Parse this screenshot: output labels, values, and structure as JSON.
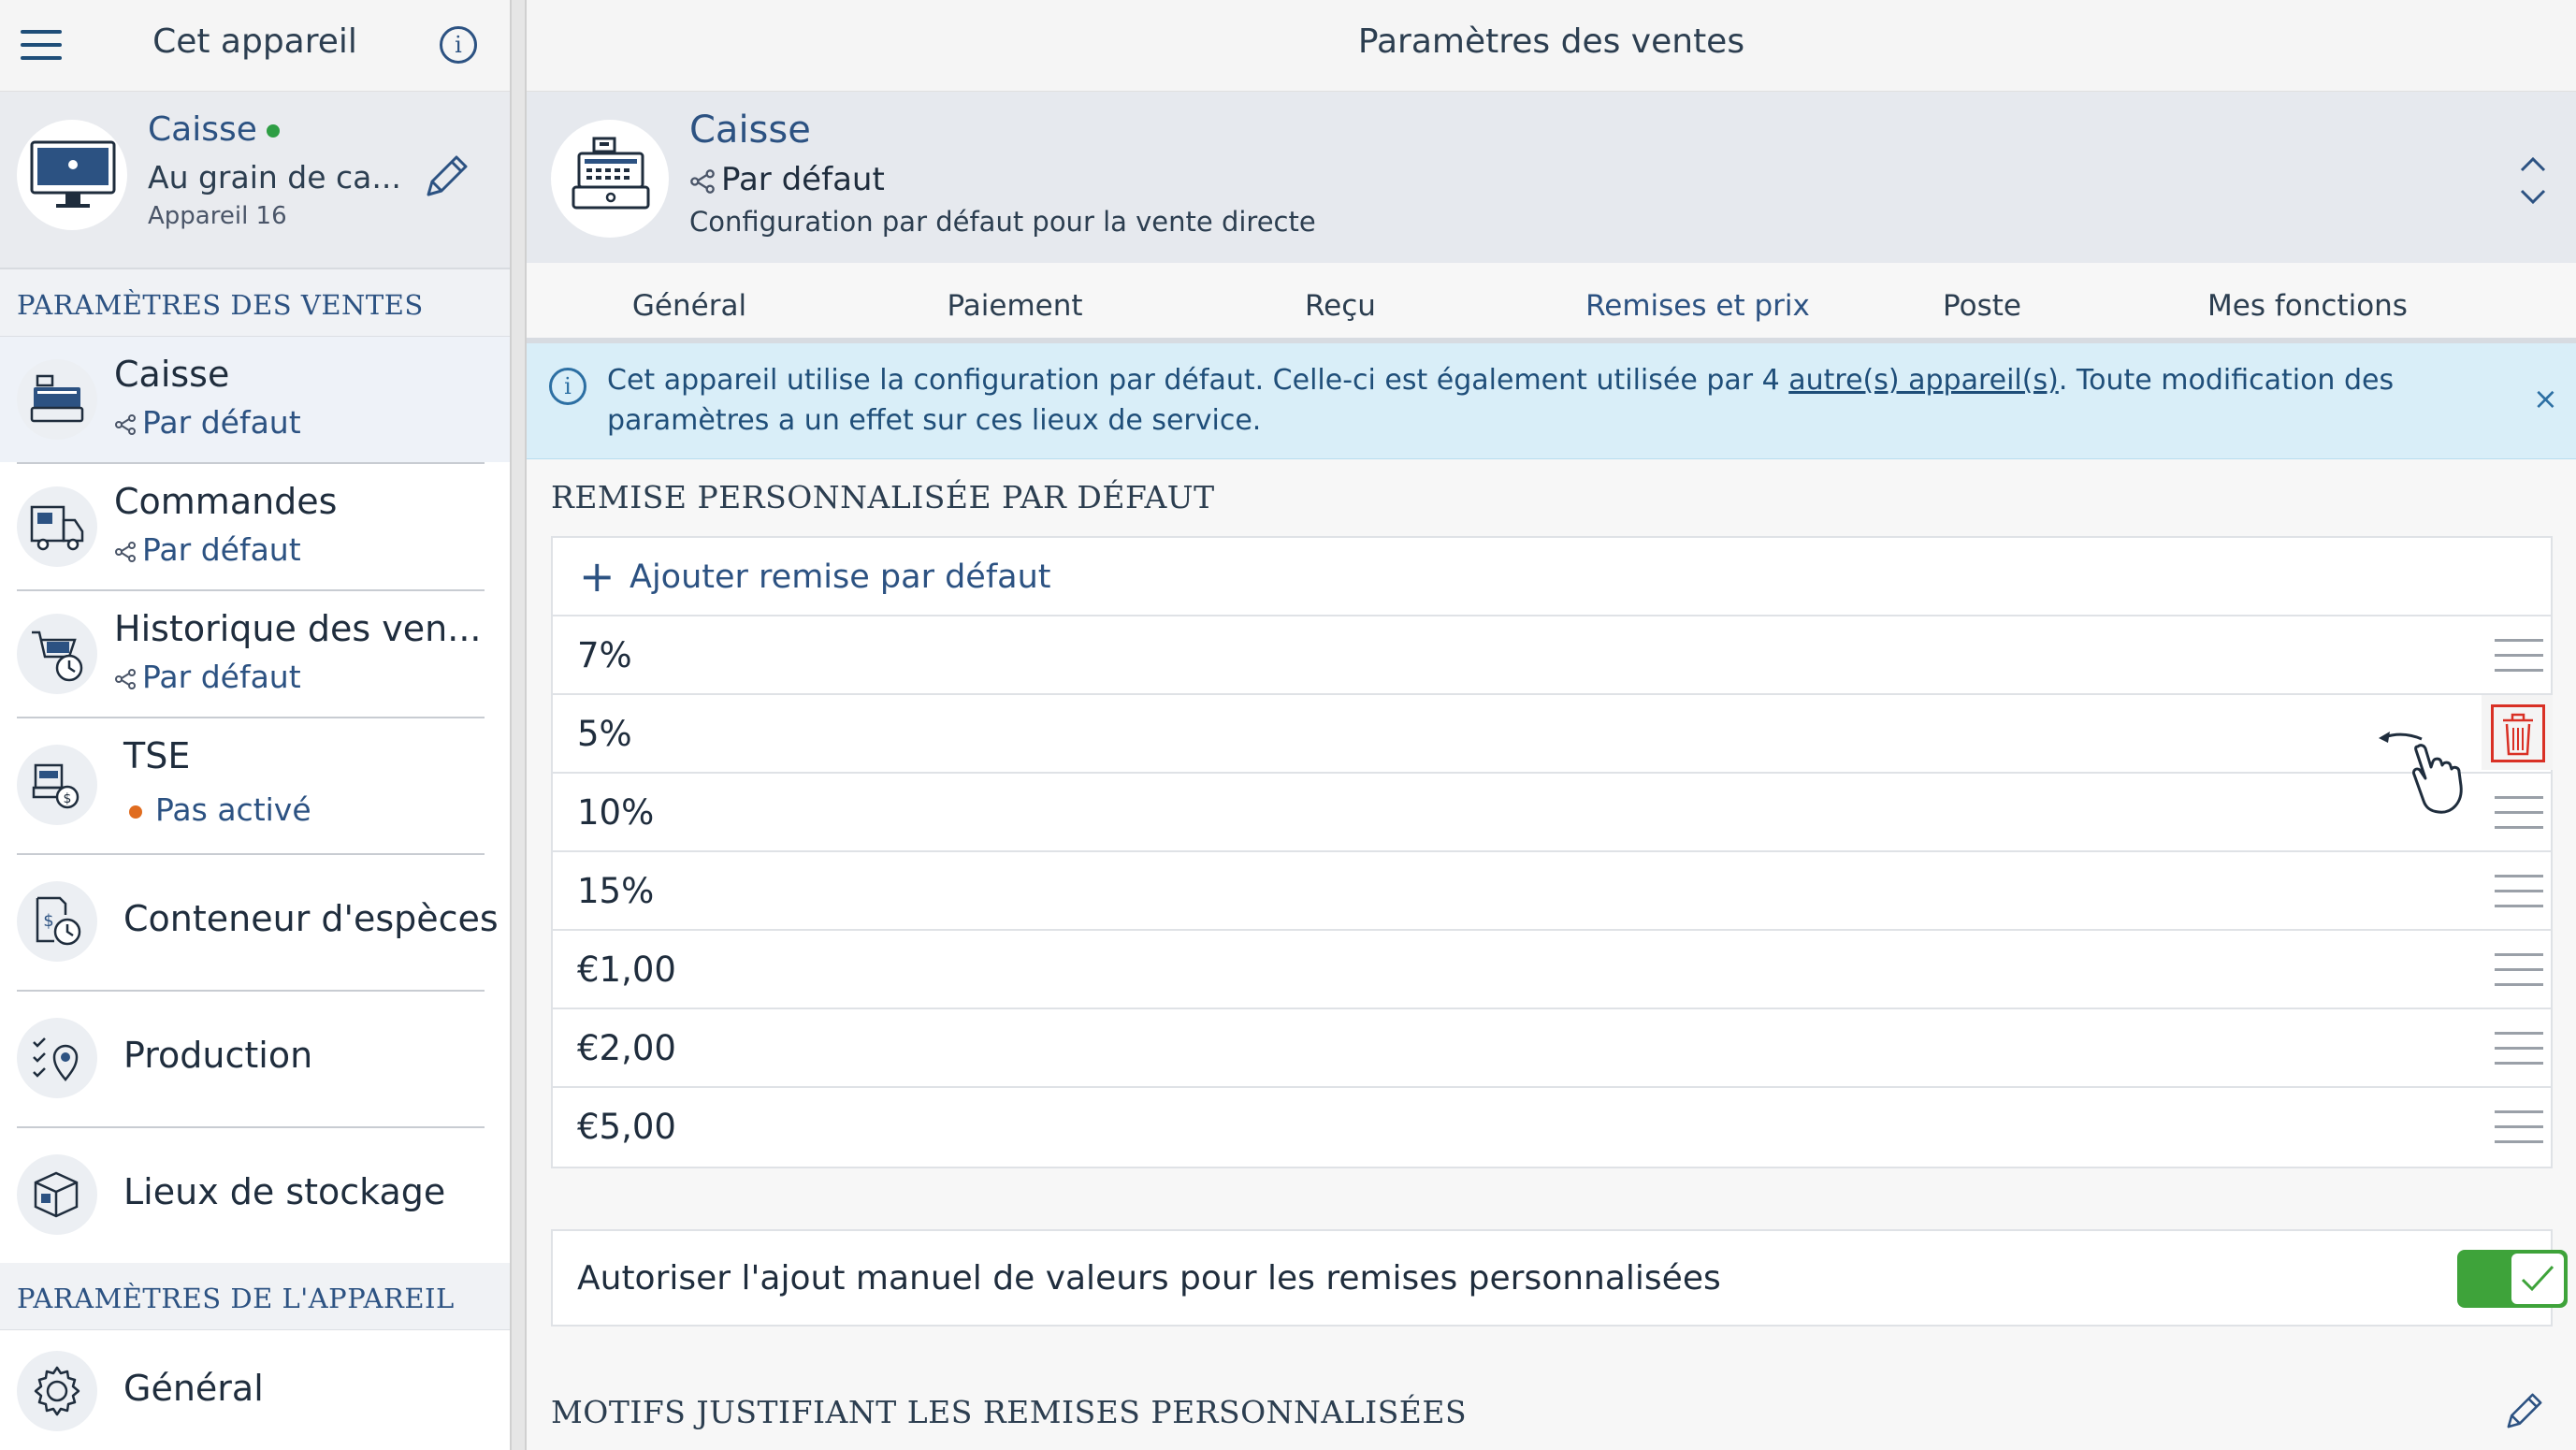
{
  "sidebar": {
    "title": "Cet appareil",
    "device": {
      "name": "Caisse",
      "status_color": "#2e9e44",
      "store": "Au grain de ca...",
      "label": "Appareil 16"
    },
    "sections": {
      "sales": "PARAMÈTRES DES VENTES",
      "device": "PARAMÈTRES DE L'APPAREIL"
    },
    "items": [
      {
        "label": "Caisse",
        "sub": "Par défaut",
        "icon": "cash-register-icon",
        "active": true
      },
      {
        "label": "Commandes",
        "sub": "Par défaut",
        "icon": "delivery-truck-icon"
      },
      {
        "label": "Historique des ven...",
        "sub": "Par défaut",
        "icon": "sales-history-icon"
      },
      {
        "label": "TSE",
        "sub": "Pas activé",
        "icon": "tse-icon",
        "status_color": "#e06c1f"
      },
      {
        "label": "Conteneur d'espèces",
        "icon": "cash-container-icon"
      },
      {
        "label": "Production",
        "icon": "production-icon"
      },
      {
        "label": "Lieux de stockage",
        "icon": "storage-icon"
      },
      {
        "label": "Général",
        "icon": "gear-icon"
      }
    ]
  },
  "main": {
    "title": "Paramètres des ventes",
    "config": {
      "name": "Caisse",
      "profile": "Par défaut",
      "description": "Configuration par défaut pour la vente directe"
    },
    "tabs": [
      {
        "label": "Général"
      },
      {
        "label": "Paiement"
      },
      {
        "label": "Reçu"
      },
      {
        "label": "Remises et prix",
        "active": true
      },
      {
        "label": "Poste"
      },
      {
        "label": "Mes fonctions"
      }
    ],
    "banner": {
      "text_before": "Cet appareil utilise la configuration par défaut. Celle-ci est également utilisée par 4 ",
      "link": "autre(s) appareil(s)",
      "text_after": ". Toute modification des paramètres a un effet sur ces lieux de service.",
      "close": "×"
    },
    "discounts": {
      "title": "REMISE PERSONNALISÉE PAR DÉFAUT",
      "add_label": "Ajouter remise par défaut",
      "values": [
        "7%",
        "5%",
        "10%",
        "15%",
        "€1,00",
        "€2,00",
        "€5,00"
      ]
    },
    "manual": {
      "label": "Autoriser l'ajout manuel de valeurs pour les remises personnalisées",
      "enabled": true
    },
    "reasons": {
      "title": "MOTIFS JUSTIFIANT LES REMISES PERSONNALISÉES"
    }
  },
  "colors": {
    "accent": "#2c5282",
    "toggle_on": "#3ea33a",
    "delete": "#d93025",
    "banner_bg": "#d9eef8"
  }
}
